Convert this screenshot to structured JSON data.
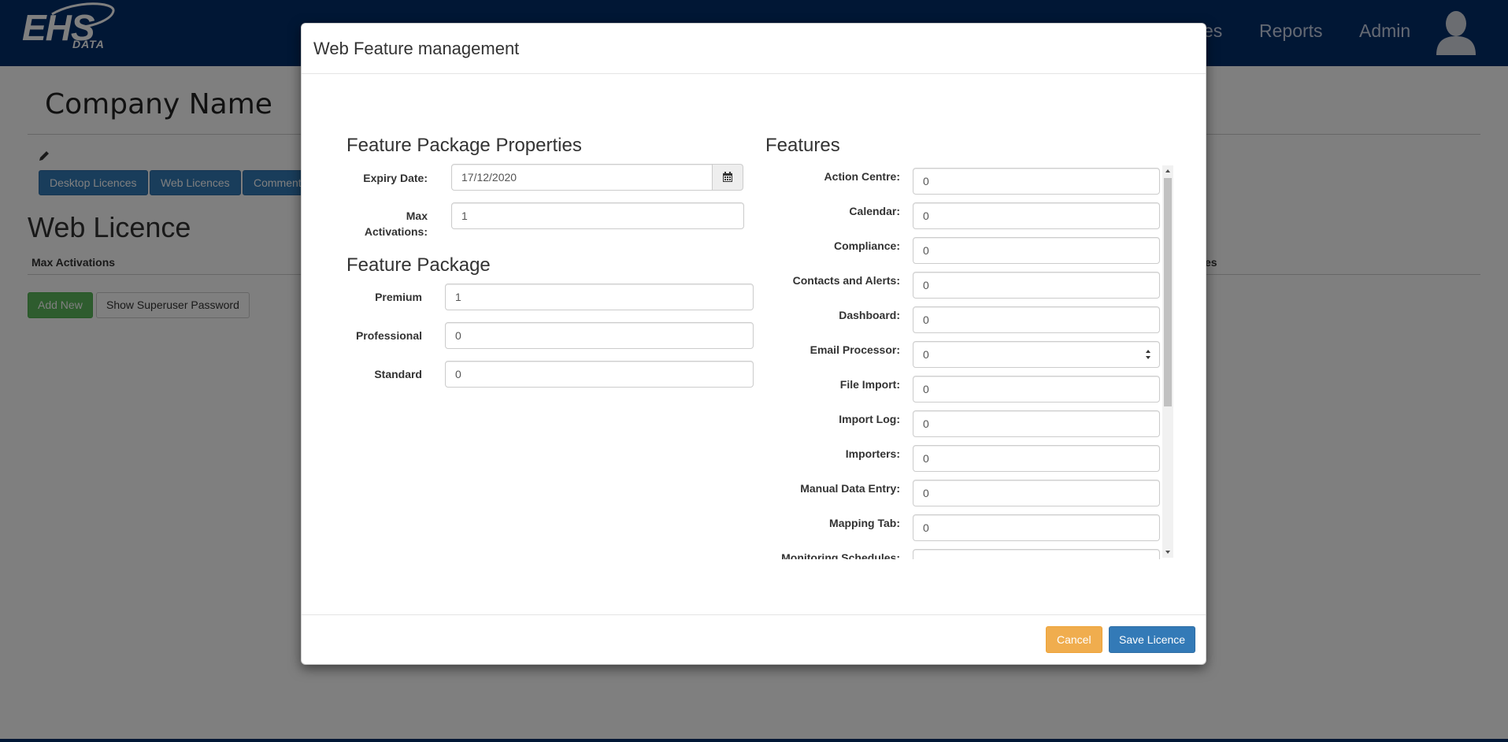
{
  "navbar": {
    "logo_text": "EHS",
    "logo_subtext": "DATA",
    "partial_item": "es",
    "items": [
      "Reports",
      "Admin"
    ],
    "user_icon": "user-silhouette-icon",
    "background_color": "#022e6b"
  },
  "page": {
    "company_name": "Company Name",
    "edit_icon": "pencil-icon",
    "tabs": [
      "Desktop Licences",
      "Web Licences",
      "Comments"
    ],
    "title": "Web Licence",
    "table_header_left": "Max Activations",
    "table_header_right": "es",
    "add_new_label": "Add New",
    "show_password_label": "Show Superuser Password"
  },
  "modal": {
    "title": "Web Feature management",
    "properties": {
      "heading": "Feature Package Properties",
      "expiry_label": "Expiry Date:",
      "expiry_value": "17/12/2020",
      "calendar_icon": "calendar-icon",
      "max_activations_label_1": "Max",
      "max_activations_label_2": "Activations:",
      "max_activations_value": "1"
    },
    "package": {
      "heading": "Feature Package",
      "rows": [
        {
          "label": "Premium",
          "value": "1"
        },
        {
          "label": "Professional",
          "value": "0"
        },
        {
          "label": "Standard",
          "value": "0"
        }
      ]
    },
    "features": {
      "heading": "Features",
      "rows": [
        {
          "label": "Action Centre:",
          "value": "0"
        },
        {
          "label": "Calendar:",
          "value": "0"
        },
        {
          "label": "Compliance:",
          "value": "0"
        },
        {
          "label": "Contacts and Alerts:",
          "value": "0"
        },
        {
          "label": "Dashboard:",
          "value": "0"
        },
        {
          "label": "Email Processor:",
          "value": "0"
        },
        {
          "label": "File Import:",
          "value": "0"
        },
        {
          "label": "Import Log:",
          "value": "0"
        },
        {
          "label": "Importers:",
          "value": "0"
        },
        {
          "label": "Manual Data Entry:",
          "value": "0"
        },
        {
          "label": "Mapping Tab:",
          "value": "0"
        },
        {
          "label": "Monitoring Schedules:",
          "value": ""
        }
      ]
    },
    "footer": {
      "cancel_label": "Cancel",
      "save_label": "Save Licence"
    }
  }
}
